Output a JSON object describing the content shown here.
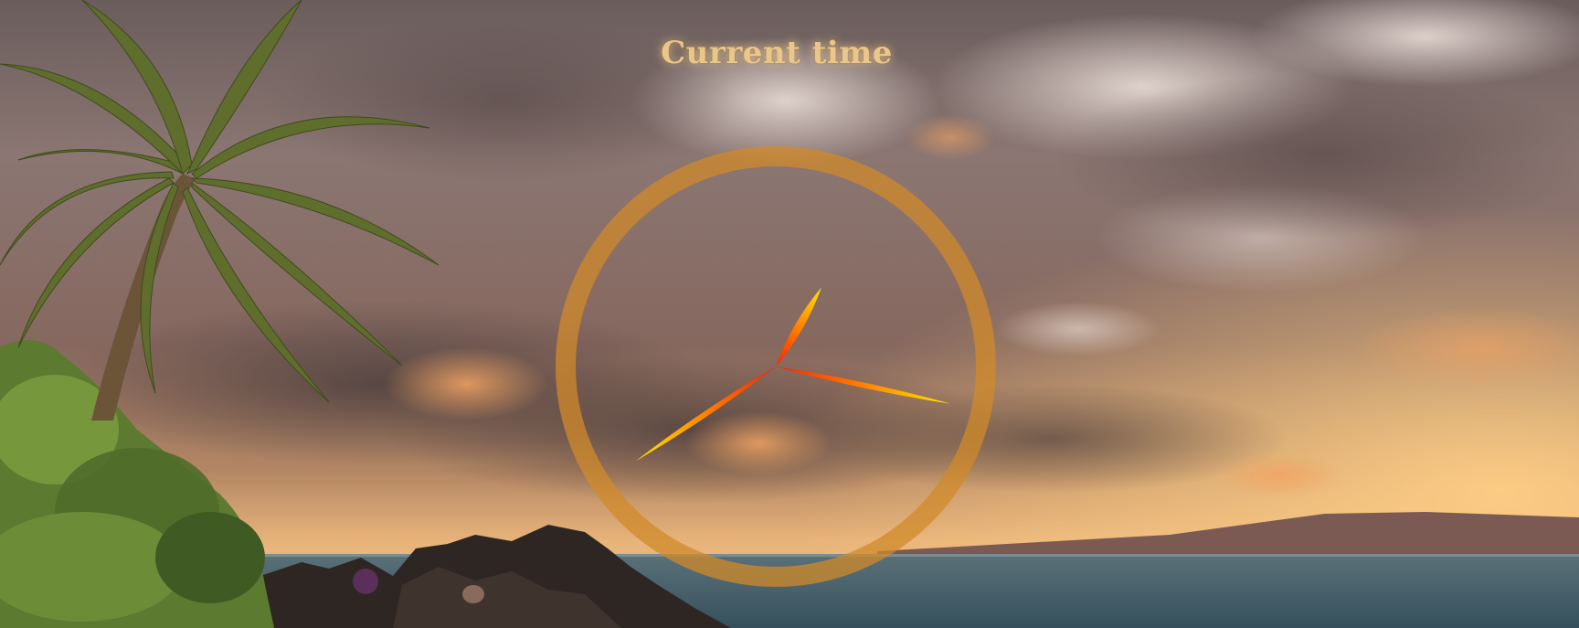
{
  "page": {
    "title": "Current time"
  },
  "clock": {
    "hands": [
      {
        "name": "hour-hand",
        "angle_deg": 30
      },
      {
        "name": "minute-hand",
        "angle_deg": 102
      },
      {
        "name": "second-hand",
        "angle_deg": 236
      }
    ],
    "colors": {
      "ring": "#d08a2a",
      "hand_base": "#ff1e00",
      "hand_tip": "#ffe600"
    }
  },
  "background": {
    "description_colors": {
      "sky_top": "#6b5b57",
      "sky_mid": "#8f7570",
      "horizon_glow": "#f3b56a",
      "sea": "#3f5b66",
      "rock": "#2e2622",
      "foliage": "#6f8b3a"
    }
  }
}
